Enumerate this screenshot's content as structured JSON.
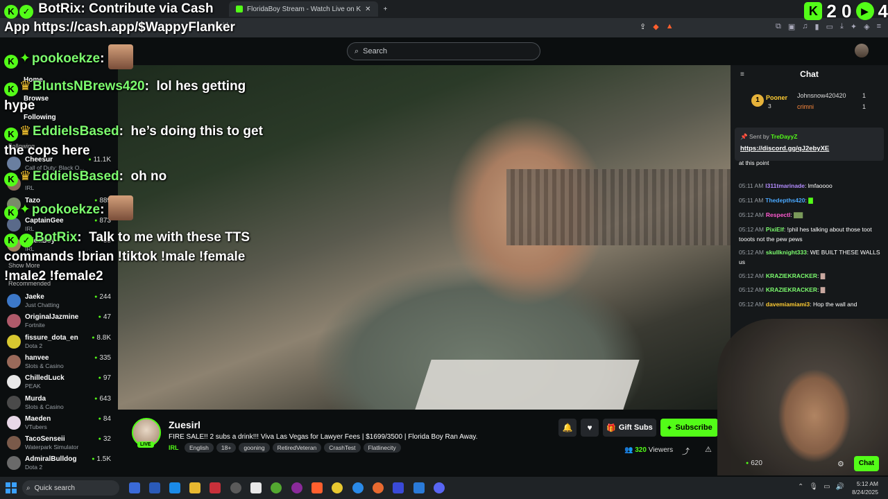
{
  "browser": {
    "tabs": [
      {
        "label": "BotRix: Contribute via Cash"
      },
      {
        "label": "FloridaBoy Stream - Watch Live on K"
      }
    ],
    "address": "zuesirl"
  },
  "header": {
    "search_placeholder": "Search"
  },
  "sidebar": {
    "nav": [
      {
        "label": "Home"
      },
      {
        "label": "Browse"
      },
      {
        "label": "Following"
      }
    ],
    "following_label": "Following",
    "following": [
      {
        "name": "Cheesur",
        "category": "Call of Duty: Black O...",
        "viewers": "11.1K",
        "color": "#6a7fa0"
      },
      {
        "name": "",
        "category": "IRL",
        "viewers": "",
        "color": "#8a6a5a"
      },
      {
        "name": "Tazo",
        "category": "",
        "viewers": "889",
        "color": "#7a8a6a"
      },
      {
        "name": "CaptainGee",
        "category": "IRL",
        "viewers": "873",
        "color": "#5a6a8a"
      },
      {
        "name": "oridaBoy",
        "category": "IRL",
        "viewers": "35",
        "color": "#a08060"
      }
    ],
    "show_more": "Show More",
    "recommended_label": "Recommended",
    "recommended": [
      {
        "name": "Jaeke",
        "category": "Just Chatting",
        "viewers": "244",
        "color": "#3c78c8"
      },
      {
        "name": "OriginalJazmine",
        "category": "Fortnite",
        "viewers": "47",
        "color": "#b05a6a"
      },
      {
        "name": "fissure_dota_en",
        "category": "Dota 2",
        "viewers": "8.8K",
        "color": "#d8c830"
      },
      {
        "name": "hanvee",
        "category": "Slots & Casino",
        "viewers": "335",
        "color": "#9a6a5a"
      },
      {
        "name": "ChilledLuck",
        "category": "PEAK",
        "viewers": "97",
        "color": "#e8e8e8"
      },
      {
        "name": "Murda",
        "category": "Slots & Casino",
        "viewers": "643",
        "color": "#4a4a4a"
      },
      {
        "name": "Maeden",
        "category": "VTubers",
        "viewers": "84",
        "color": "#e8d8e8"
      },
      {
        "name": "TacoSenseii",
        "category": "Waterpark Simulator",
        "viewers": "32",
        "color": "#7a5a4a"
      },
      {
        "name": "AdmiralBulldog",
        "category": "Dota 2",
        "viewers": "1.5K",
        "color": "#6a6a6a"
      }
    ]
  },
  "overlay": {
    "top_line1": "BotRix: Contribute via Cash",
    "top_line2": "App https://cash.app/$WappyFlanker",
    "counter1": "2 0",
    "counter2": "4",
    "messages": [
      {
        "user": "pookoekze",
        "text": ""
      },
      {
        "user": "BluntsNBrews420",
        "text": "lol hes getting",
        "text2": "hype"
      },
      {
        "user": "EddieIsBased",
        "text": "he’s doing this to get",
        "text2": "the cops here"
      },
      {
        "user": "EddieIsBased",
        "text": "oh no"
      },
      {
        "user": "pookoekze",
        "text": ""
      },
      {
        "user": "BotRix",
        "text": "Talk to me with these TTS",
        "text2": "commands !brian !tiktok !male !female",
        "text3": "!male2 !female2"
      }
    ]
  },
  "stream": {
    "streamer": "Zuesirl",
    "live_label": "LIVE",
    "title": "FIRE SALE!! 2 subs a drink!!! Viva Las Vegas for Lawyer Fees | $1699/3500 | Florida Boy Ran Away.",
    "category": "IRL",
    "tags": [
      "English",
      "18+",
      "gooning",
      "RetiredVeteran",
      "CrashTest",
      "Flatlinecity"
    ],
    "gift_label": "Gift Subs",
    "subscribe_label": "Subscribe",
    "viewers": "320",
    "viewers_label": "Viewers"
  },
  "chat": {
    "title": "Chat",
    "leaderboard": {
      "rank": "1",
      "top_name": "Pooner",
      "top_score": "3",
      "rows": [
        {
          "name": "Johnsnow420420",
          "value": "1",
          "color": "#dddddd"
        },
        {
          "name": "crimni",
          "value": "1",
          "color": "#ff8a3d"
        }
      ]
    },
    "pinned": {
      "sent_by": "Sent by",
      "user": "TreDayyZ",
      "link": "https://discord.gg/qJ2ebyXE"
    },
    "messages": [
      {
        "time": "",
        "user": "",
        "text": "at this point",
        "color": "#ffffff"
      },
      {
        "time": "05:11 AM",
        "user": "l311tmarinade",
        "text": "lmfaoooo",
        "color": "#b48cff"
      },
      {
        "time": "05:11 AM",
        "user": "Thedepths420",
        "text": "",
        "color": "#4aa8ff"
      },
      {
        "time": "05:12 AM",
        "user": "RespectI",
        "text": "",
        "color": "#ff5ad1"
      },
      {
        "time": "05:12 AM",
        "user": "PixiElf",
        "text": "!phil hes talking about those toot tooots not the pew pews",
        "color": "#7CFC6E"
      },
      {
        "time": "05:12 AM",
        "user": "skullknight333",
        "text": "WE BUILT THESE WALLS us",
        "color": "#7CFC6E"
      },
      {
        "time": "05:12 AM",
        "user": "KRAZIEKRACKER",
        "text": "",
        "color": "#7CFC6E"
      },
      {
        "time": "05:12 AM",
        "user": "KRAZIEKRACKER",
        "text": "",
        "color": "#7CFC6E"
      },
      {
        "time": "05:12 AM",
        "user": "davemiamiami3",
        "text": "Hop the wall and",
        "color": "#ffcc33"
      }
    ],
    "pill_label": "Chat",
    "cam_count": "620"
  },
  "taskbar": {
    "search_label": "Quick search",
    "time": "5:12 AM",
    "date": "8/24/2025"
  }
}
